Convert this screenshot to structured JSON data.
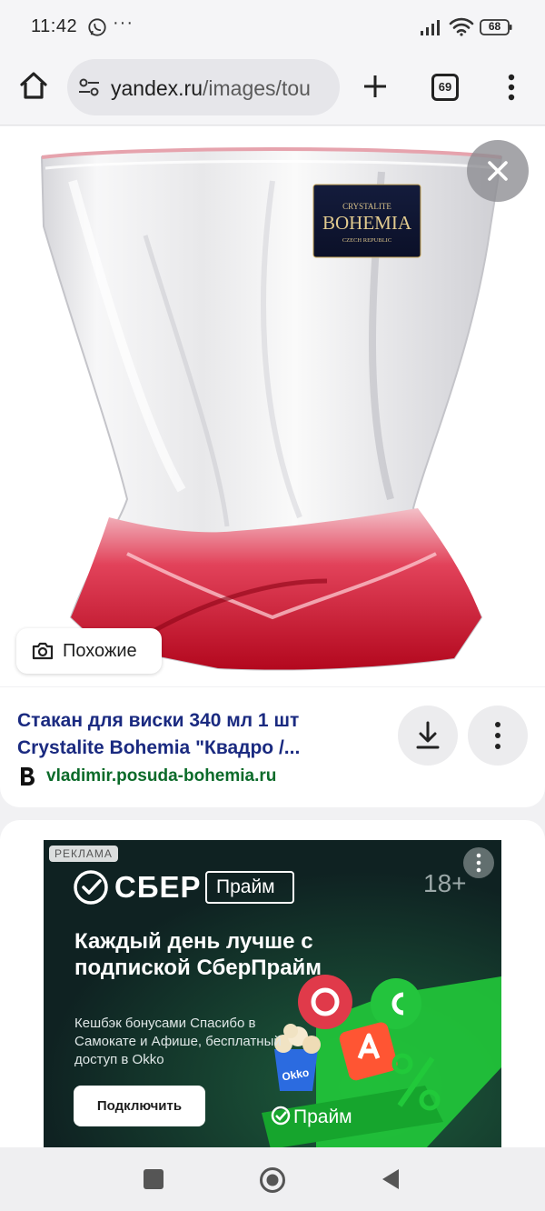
{
  "status_bar": {
    "time": "11:42",
    "more": "···",
    "battery": "68",
    "icons": [
      "whatsapp-icon",
      "signal-icon",
      "wifi-icon",
      "battery-icon"
    ]
  },
  "browser": {
    "url_domain": "yandex.ru",
    "url_path": "/images/tou",
    "tab_count": "69",
    "icons": [
      "home-icon",
      "site-settings-icon",
      "plus-icon",
      "menu-dots-icon"
    ]
  },
  "viewer": {
    "similar_label": "Похожие",
    "label_brand_small": "CRYSTALITE",
    "label_brand": "BOHEMIA",
    "label_country": "CZECH REPUBLIC",
    "icons": [
      "close-icon",
      "camera-search-icon"
    ]
  },
  "result": {
    "title": "Стакан для виски 340 мл 1 шт Crystalite Bohemia \"Квадро /...",
    "source": "vladimir.posuda-bohemia.ru",
    "icons": [
      "download-icon",
      "more-vertical-icon",
      "yandex-b-icon"
    ]
  },
  "ad": {
    "label": "РЕКЛАМА",
    "brand": "СБЕР",
    "prime": "Прайм",
    "age": "18+",
    "headline": "Каждый день лучше с подпиской СберПрайм",
    "body": "Кешбэк бонусами Спасибо в Самокате и Афише, бесплатный доступ в Okko",
    "button": "Подключить",
    "ribbon": "Прайм",
    "cup_text": "Okko",
    "colors": {
      "background": "#0f2222",
      "accent_green": "#21c93a"
    }
  },
  "nav": {
    "icons": [
      "recent-apps-icon",
      "home-circle-icon",
      "back-icon"
    ]
  }
}
